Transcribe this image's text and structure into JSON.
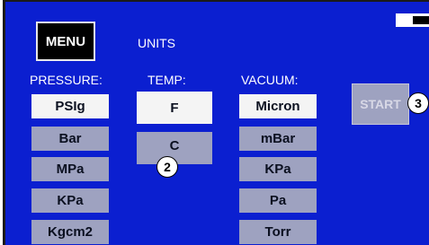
{
  "header": {
    "menu_label": "MENU",
    "units_label": "UNITS"
  },
  "pressure": {
    "heading": "PRESSURE:",
    "options": [
      "PSIg",
      "Bar",
      "MPa",
      "KPa",
      "Kgcm2"
    ],
    "selected": "PSIg"
  },
  "temp": {
    "heading": "TEMP:",
    "options": [
      "F",
      "C"
    ],
    "selected": "F"
  },
  "vacuum": {
    "heading": "VACUUM:",
    "options": [
      "Micron",
      "mBar",
      "KPa",
      "Pa",
      "Torr"
    ],
    "selected": "Micron"
  },
  "start_label": "START",
  "callouts": {
    "temp": "2",
    "start": "3"
  },
  "colors": {
    "screen_bg": "#0b1fd0",
    "button_selected": "#f4f4f4",
    "button_unselected": "#9ea2c0"
  },
  "icons": {
    "battery": "battery-icon"
  }
}
